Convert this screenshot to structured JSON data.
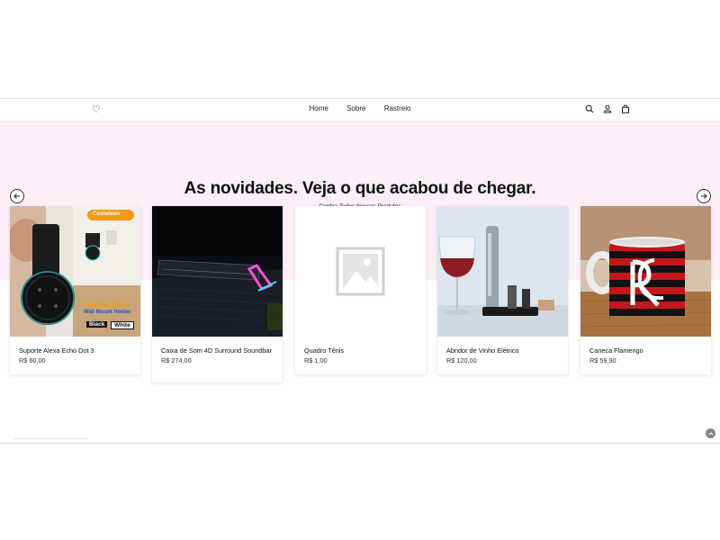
{
  "nav": {
    "logo_text": "♡",
    "links": [
      "Home",
      "Sobre",
      "Rastreio"
    ],
    "icons": [
      "search-icon",
      "account-icon",
      "cart-icon"
    ]
  },
  "hero": {
    "title": "As novidades. Veja o que acabou de chegar.",
    "subtitle": "Confira Todos Nossos Produtos",
    "background": "#fdeef8"
  },
  "products": [
    {
      "name": "Suporte Alexa Echo Dot 3",
      "price": "R$ 60,00",
      "image_text": {
        "brand": "Costwleen",
        "line1": "Amazon Dot 3",
        "line2": "Wall Mount Holder",
        "tag_black": "Black",
        "tag_white": "White"
      }
    },
    {
      "name": "Caixa de Som 4D Surround Soundbar",
      "price": "R$ 274,00"
    },
    {
      "name": "Quadro Tênis",
      "price": "R$ 1,00"
    },
    {
      "name": "Abridor de Vinho Elétrico",
      "price": "R$ 120,00"
    },
    {
      "name": "Caneca Flamengo",
      "price": "R$ 59,90"
    }
  ]
}
